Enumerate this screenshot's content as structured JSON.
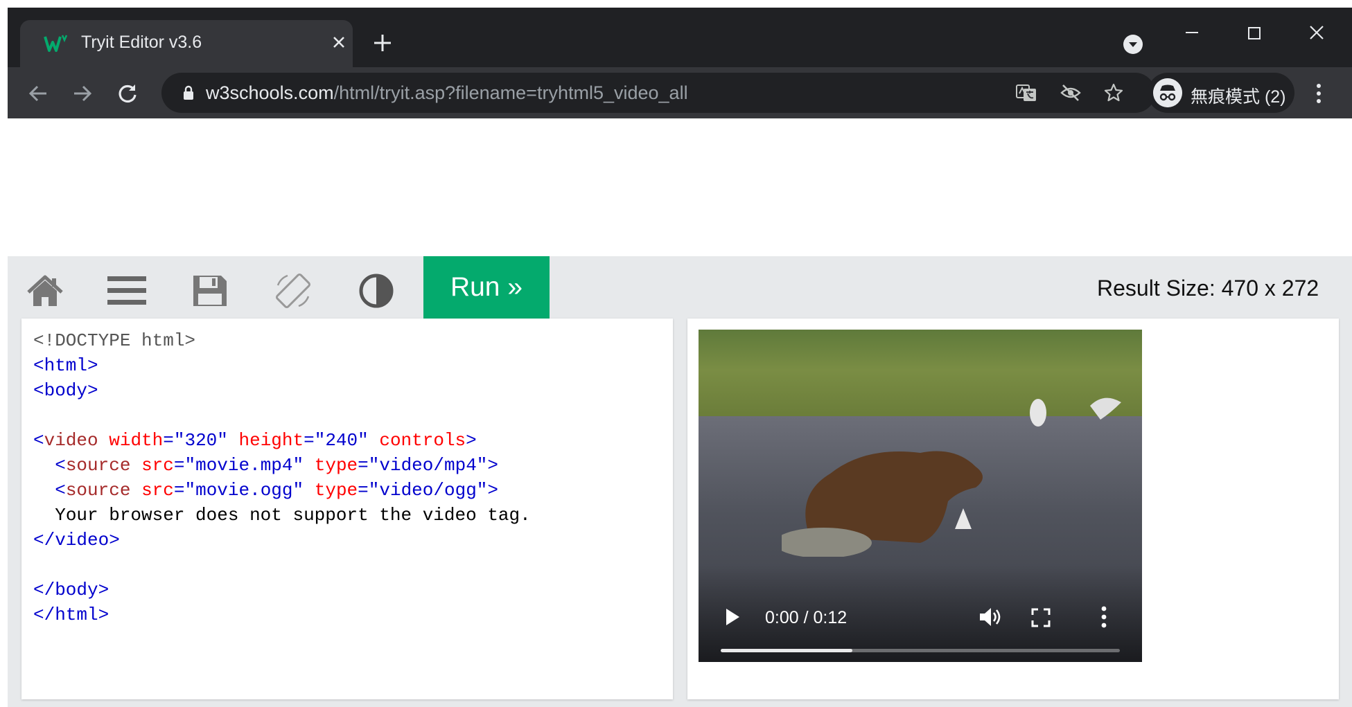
{
  "browser": {
    "tab_title": "Tryit Editor v3.6",
    "url_host": "w3schools.com",
    "url_path": "/html/tryit.asp?filename=tryhtml5_video_all",
    "profile_label": "無痕模式 (2)"
  },
  "toolbar": {
    "run_label": "Run »",
    "result_size": "Result Size: 470 x 272"
  },
  "code": {
    "doctype": "<!DOCTYPE html>",
    "html_open": "<html>",
    "body_open": "<body>",
    "video_tag": "video",
    "width_attr": "width",
    "width_val": "\"320\"",
    "height_attr": "height",
    "height_val": "\"240\"",
    "controls_attr": "controls",
    "source_tag": "source",
    "src_attr": "src",
    "src1_val": "\"movie.mp4\"",
    "type_attr": "type",
    "type1_val": "\"video/mp4\"",
    "src2_val": "\"movie.ogg\"",
    "type2_val": "\"video/ogg\"",
    "fallback_text": "Your browser does not support the video tag.",
    "video_close": "</video>",
    "body_close": "</body>",
    "html_close": "</html>"
  },
  "video_player": {
    "time": "0:00 / 0:12",
    "buffered_fraction": 0.33
  },
  "colors": {
    "run_green": "#04aa6d",
    "chrome_dark": "#202124",
    "chrome_tab": "#35363a"
  }
}
